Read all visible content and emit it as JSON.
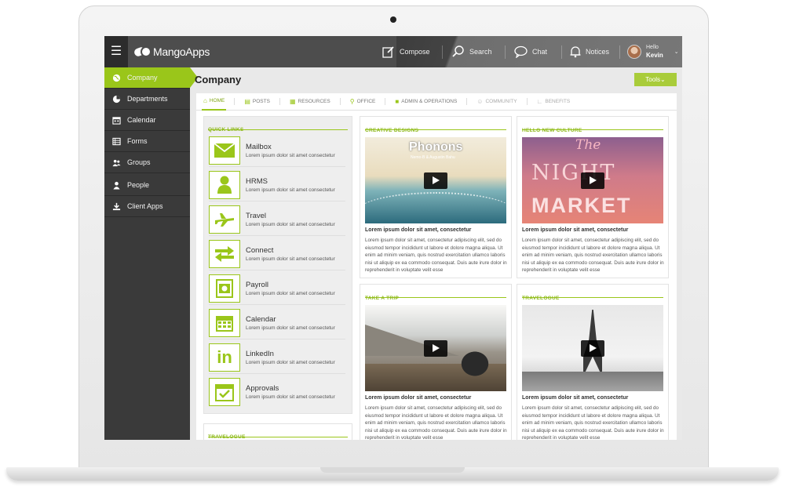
{
  "app": {
    "name": "MangoApps",
    "accent_color": "#9ac61a",
    "topbar_color": "#4d4d4d",
    "sidebar_color": "#3a3a3a"
  },
  "topbar": {
    "menu_icon": "hamburger-icon",
    "compose": {
      "label": "Compose",
      "icon": "compose-icon"
    },
    "search": {
      "label": "Search",
      "icon": "search-icon"
    },
    "chat": {
      "label": "Chat",
      "icon": "chat-icon"
    },
    "notices": {
      "label": "Notices",
      "icon": "bell-icon"
    },
    "user": {
      "greeting": "Hello",
      "name": "Kevin"
    }
  },
  "sidebar": {
    "items": [
      {
        "label": "Company",
        "icon": "globe-icon",
        "active": true
      },
      {
        "label": "Departments",
        "icon": "pie-icon"
      },
      {
        "label": "Calendar",
        "icon": "calendar-icon"
      },
      {
        "label": "Forms",
        "icon": "forms-icon"
      },
      {
        "label": "Groups",
        "icon": "groups-icon"
      },
      {
        "label": "People",
        "icon": "person-icon"
      },
      {
        "label": "Client Apps",
        "icon": "download-icon"
      }
    ]
  },
  "page": {
    "title": "Company",
    "tools_label": "Tools"
  },
  "tabs": [
    {
      "label": "HOME",
      "icon": "home-icon"
    },
    {
      "label": "POSTS",
      "icon": "posts-icon"
    },
    {
      "label": "RESOURCES",
      "icon": "resources-icon"
    },
    {
      "label": "OFFICE",
      "icon": "pin-icon"
    },
    {
      "label": "ADMIN & OPERATIONS",
      "icon": "lock-icon"
    },
    {
      "label": "COMMUNITY",
      "icon": "community-icon"
    },
    {
      "label": "BENEFITS",
      "icon": "chart-icon"
    }
  ],
  "quick_links": {
    "heading": "QUICK LINKS",
    "items": [
      {
        "title": "Mailbox",
        "subtitle": "Lorem ipsum dolor sit amet consectetur",
        "icon": "mail-icon"
      },
      {
        "title": "HRMS",
        "subtitle": "Lorem ipsum dolor sit amet consectetur",
        "icon": "person-icon"
      },
      {
        "title": "Travel",
        "subtitle": "Lorem ipsum dolor sit amet consectetur",
        "icon": "plane-icon"
      },
      {
        "title": "Connect",
        "subtitle": "Lorem ipsum dolor sit amet consectetur",
        "icon": "transfer-icon"
      },
      {
        "title": "Payroll",
        "subtitle": "Lorem ipsum dolor sit amet consectetur",
        "icon": "money-icon"
      },
      {
        "title": "Calendar",
        "subtitle": "Lorem ipsum dolor sit amet consectetur",
        "icon": "calendar-icon"
      },
      {
        "title": "LinkedIn",
        "subtitle": "Lorem ipsum dolor sit amet consectetur",
        "icon": "linkedin-icon"
      },
      {
        "title": "Approvals",
        "subtitle": "Lorem ipsum dolor sit amet consectetur",
        "icon": "approval-icon"
      }
    ],
    "bottom_heading": "TRAVELOGUE"
  },
  "cards": [
    {
      "label": "CREATIVE DESIGNS",
      "media_title": "Phonons",
      "media_subtitle": "Nemo-B & Augustin Bahu",
      "title": "Lorem ipsum dolor sit amet, consectetur",
      "body": "Lorem ipsum dolor sit amet, consectetur adipiscing elit, sed do eiusmod tempor incididunt ut labore et dolore magna aliqua. Ut enim ad minim veniam, quis nostrud exercitation ullamco laboris nisi ut aliquip ex ea commodo consequat. Duis aute irure dolor in reprehenderit in voluptate velit esse"
    },
    {
      "label": "HELLO NEW CULTURE",
      "media_line1": "The",
      "media_line2": "NIGHT",
      "media_line3": "MARKET",
      "title": "Lorem ipsum dolor sit amet, consectetur",
      "body": "Lorem ipsum dolor sit amet, consectetur adipiscing elit, sed do eiusmod tempor incididunt ut labore et dolore magna aliqua. Ut enim ad minim veniam, quis nostrud exercitation ullamco laboris nisi ut aliquip ex ea commodo consequat. Duis aute irure dolor in reprehenderit in voluptate velit esse"
    },
    {
      "label": "TAKE A TRIP",
      "title": "Lorem ipsum dolor sit amet, consectetur",
      "body": "Lorem ipsum dolor sit amet, consectetur adipiscing elit, sed do eiusmod tempor incididunt ut labore et dolore magna aliqua. Ut enim ad minim veniam, quis nostrud exercitation ullamco laboris nisi ut aliquip ex ea commodo consequat. Duis aute irure dolor in reprehenderit in voluptate velit esse"
    },
    {
      "label": "TRAVELOGUE",
      "title": "Lorem ipsum dolor sit amet, consectetur",
      "body": "Lorem ipsum dolor sit amet, consectetur adipiscing elit, sed do eiusmod tempor incididunt ut labore et dolore magna aliqua. Ut enim ad minim veniam, quis nostrud exercitation ullamco laboris nisi ut aliquip ex ea commodo consequat. Duis aute irure dolor in reprehenderit in voluptate velit esse"
    }
  ]
}
